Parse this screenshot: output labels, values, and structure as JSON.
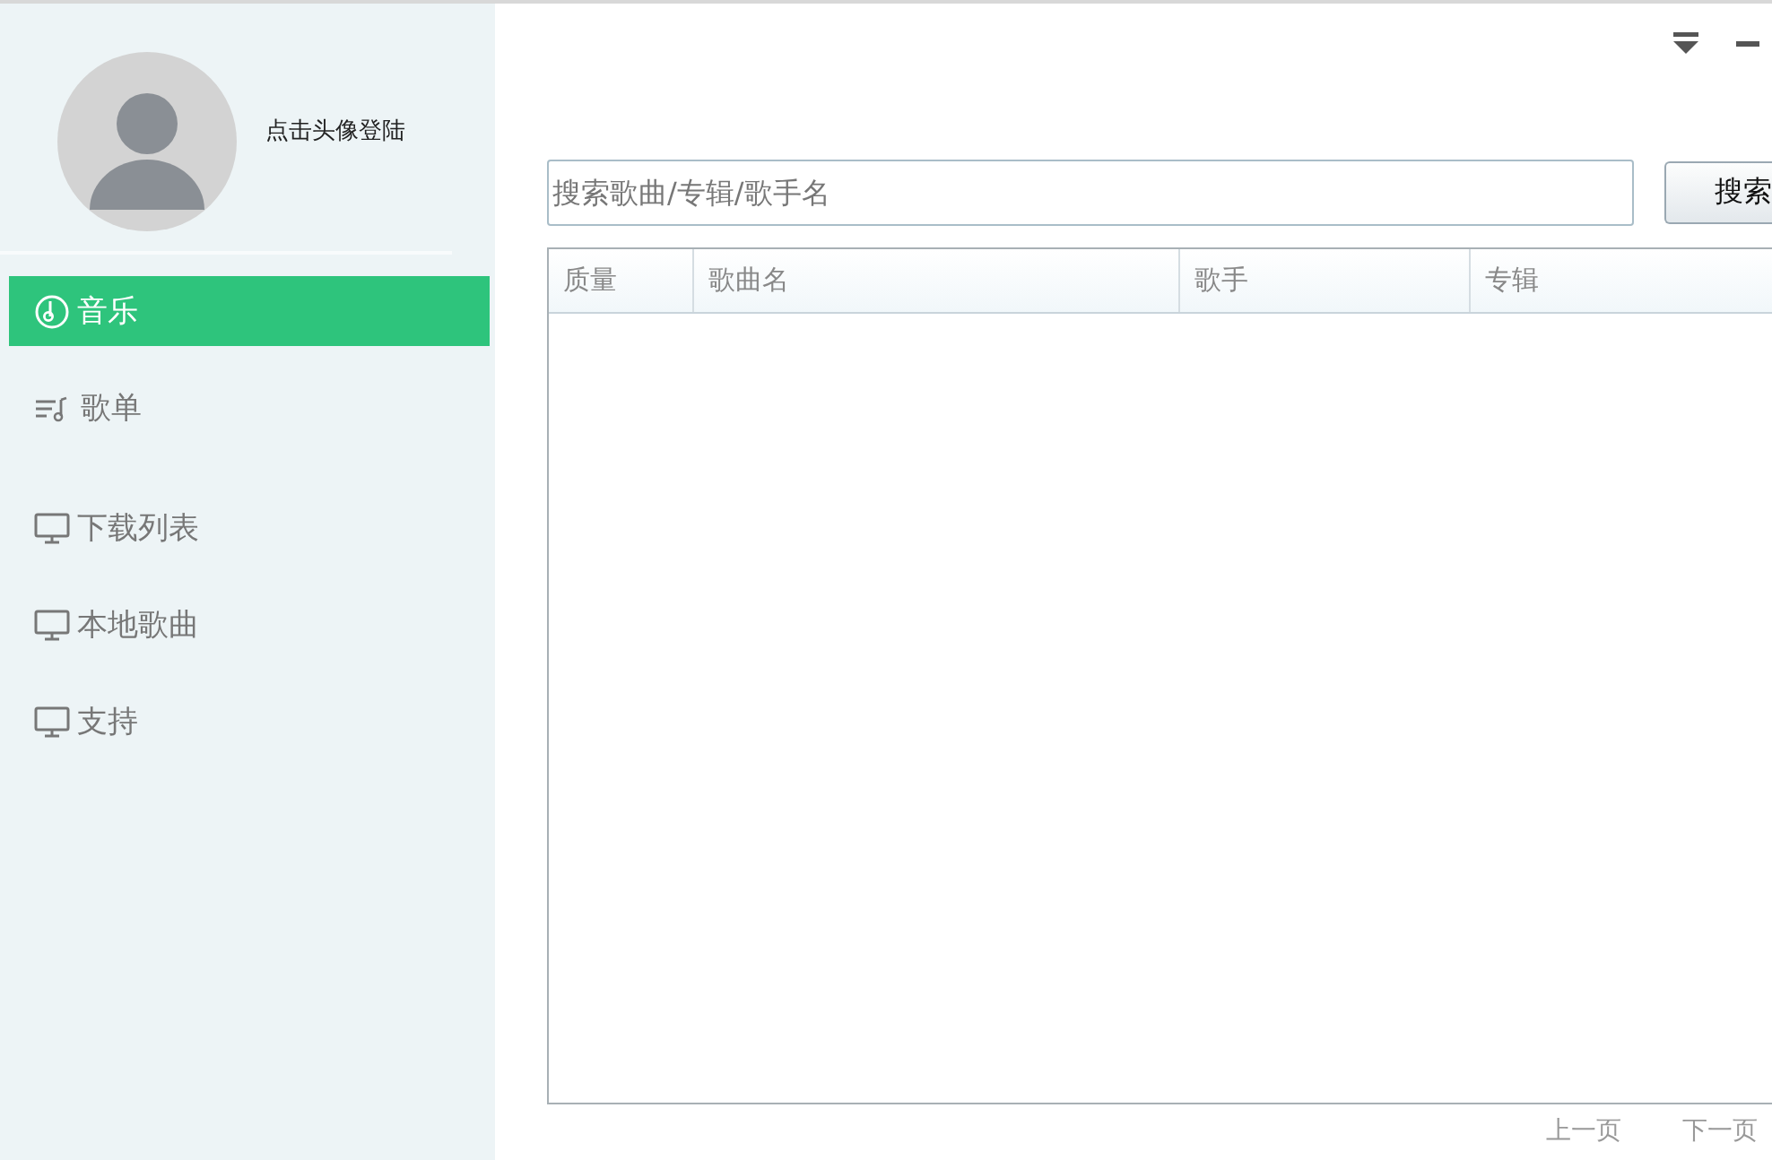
{
  "user": {
    "login_hint": "点击头像登陆"
  },
  "sidebar": {
    "items": [
      {
        "label": "音乐",
        "kind": "music",
        "selected": true
      },
      {
        "label": "歌单",
        "kind": "playlist",
        "selected": false
      },
      {
        "label": "下载列表",
        "kind": "monitor",
        "selected": false
      },
      {
        "label": "本地歌曲",
        "kind": "monitor",
        "selected": false
      },
      {
        "label": "支持",
        "kind": "monitor",
        "selected": false
      }
    ]
  },
  "search": {
    "placeholder": "搜索歌曲/专辑/歌手名",
    "button": "搜索"
  },
  "table": {
    "columns": [
      "质量",
      "歌曲名",
      "歌手",
      "专辑"
    ]
  },
  "pagination": {
    "prev": "上一页",
    "next": "下一页"
  }
}
